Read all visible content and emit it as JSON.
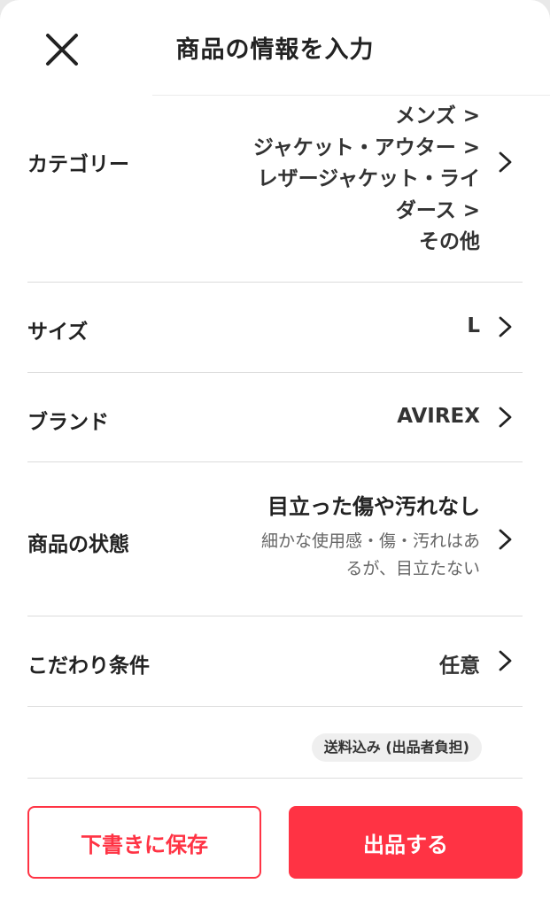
{
  "header": {
    "title": "商品の情報を入力"
  },
  "rows": {
    "category": {
      "label": "カテゴリー",
      "lines": [
        "メンズ >",
        "ジャケット・アウター >",
        "レザージャケット・ライ",
        "ダース >",
        "その他"
      ]
    },
    "size": {
      "label": "サイズ",
      "value": "L"
    },
    "brand": {
      "label": "ブランド",
      "value": "AVIREX"
    },
    "condition": {
      "label": "商品の状態",
      "value": "目立った傷や汚れなし",
      "desc_lines": [
        "細かな使用感・傷・汚れはあ",
        "るが、目立たない"
      ]
    },
    "preferences": {
      "label": "こだわり条件",
      "value": "任意"
    }
  },
  "shipping_badge": "送料込み (出品者負担)",
  "footer": {
    "draft_label": "下書きに保存",
    "list_label": "出品する"
  },
  "colors": {
    "accent": "#ff3344",
    "divider": "#dcdcdc",
    "muted": "#888888"
  },
  "icons": {
    "close": "close-icon",
    "chevron": "chevron-right-icon"
  }
}
